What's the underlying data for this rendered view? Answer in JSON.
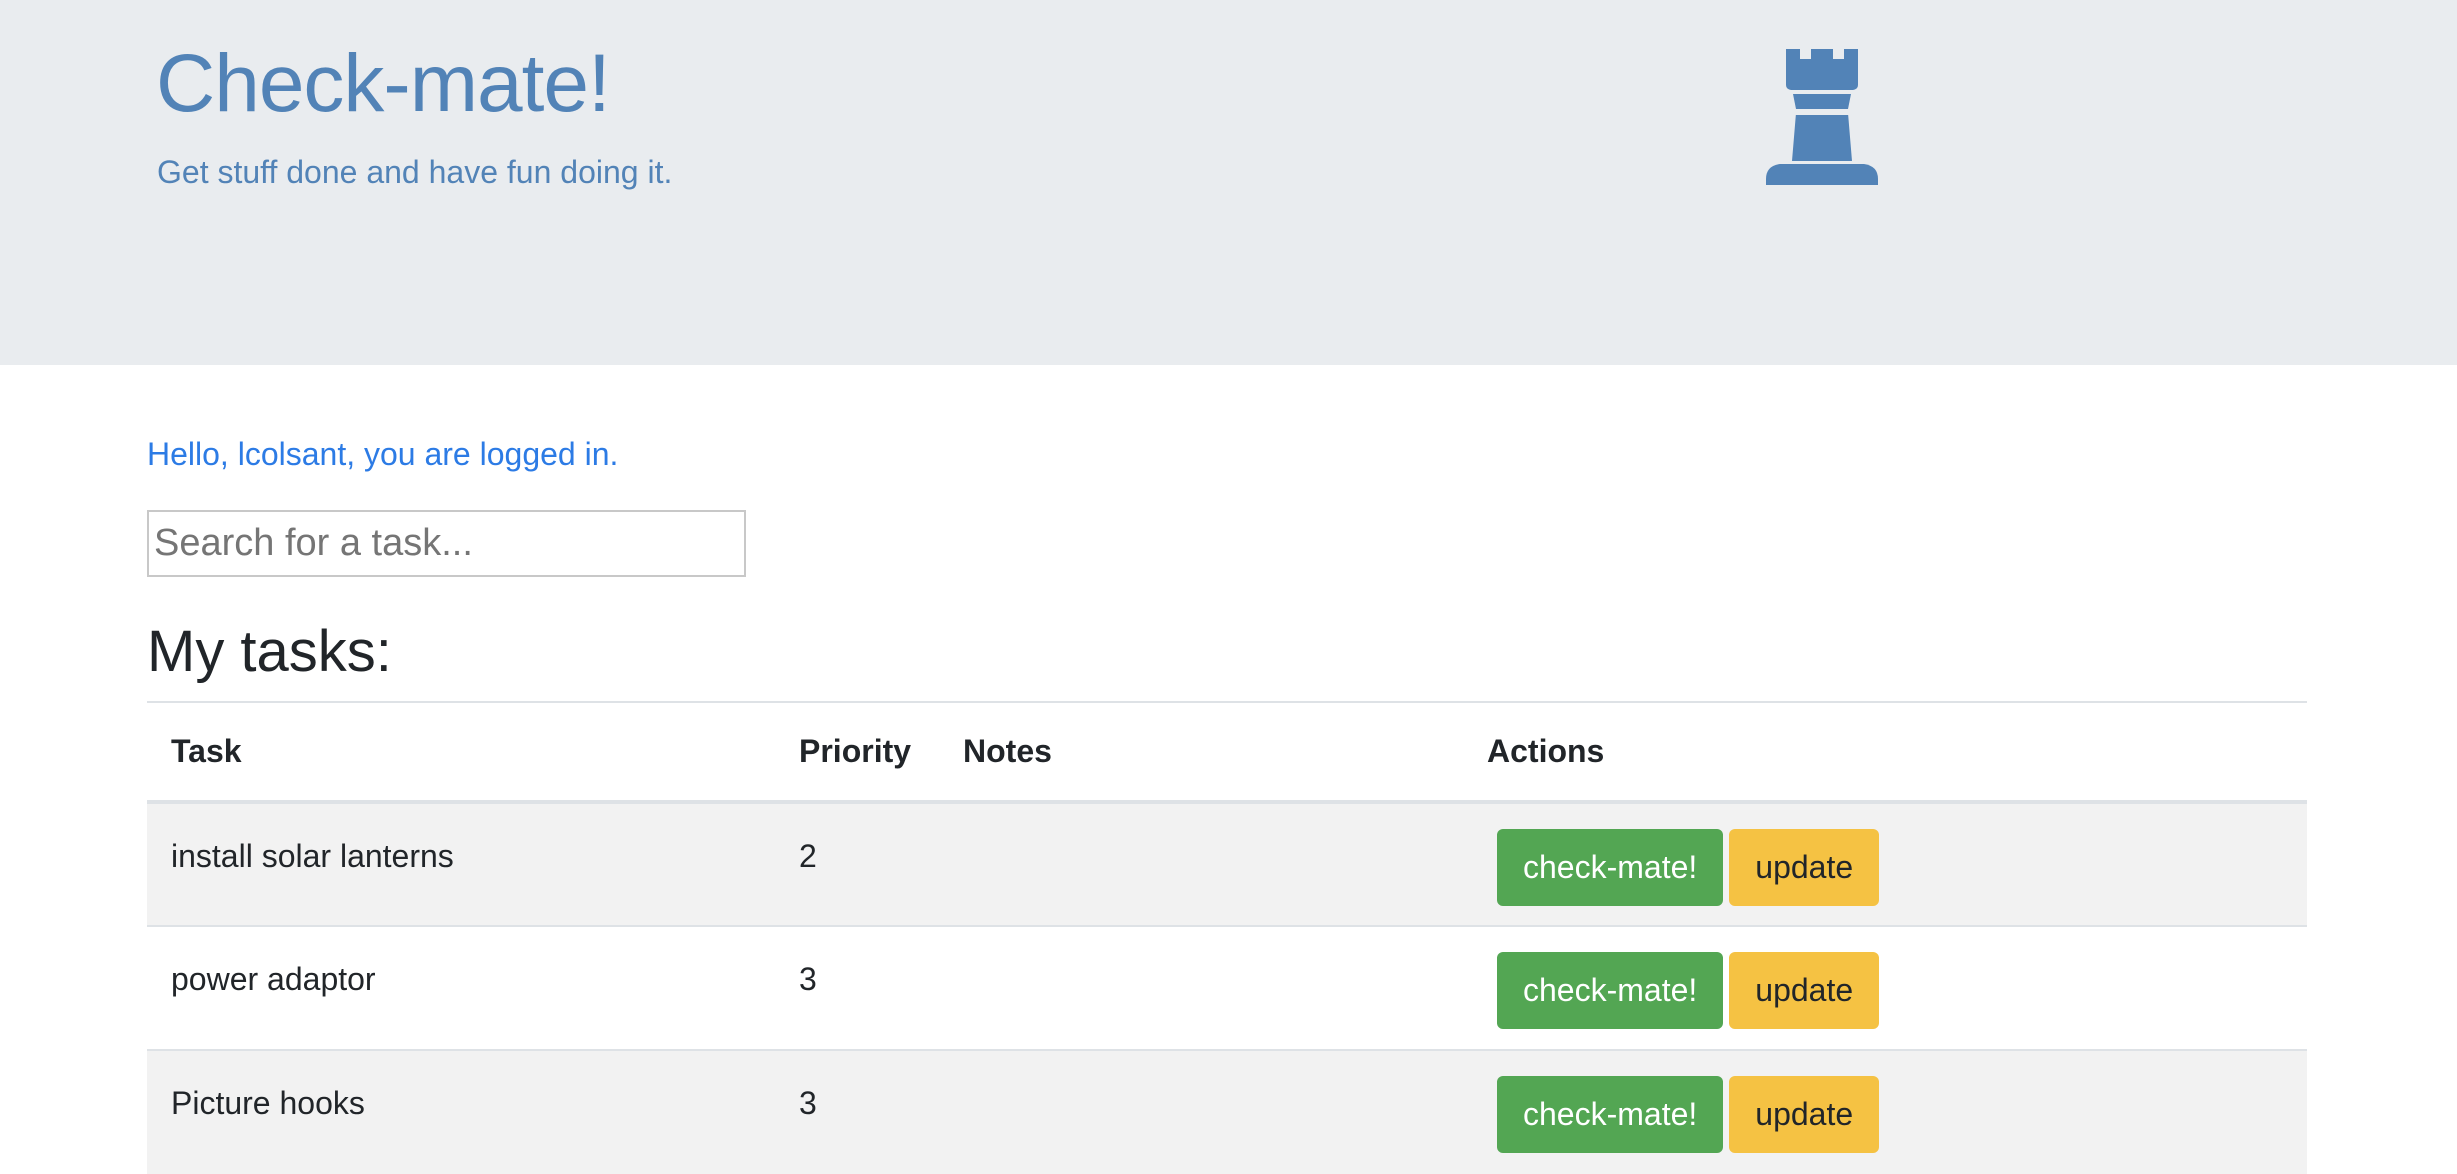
{
  "header": {
    "title": "Check-mate!",
    "tagline": "Get stuff done and have fun doing it.",
    "logo_icon": "chess-rook-icon",
    "brand_color": "#5283b7",
    "background_color": "#e9ecef"
  },
  "greeting": "Hello, lcolsant, you are logged in.",
  "search": {
    "placeholder": "Search for a task...",
    "value": ""
  },
  "tasks_section": {
    "title": "My tasks:",
    "columns": [
      "Task",
      "Priority",
      "Notes",
      "Actions"
    ],
    "rows": [
      {
        "task": "install solar lanterns",
        "priority": "2",
        "notes": "",
        "checkmate_label": "check-mate!",
        "update_label": "update"
      },
      {
        "task": "power adaptor",
        "priority": "3",
        "notes": "",
        "checkmate_label": "check-mate!",
        "update_label": "update"
      },
      {
        "task": "Picture hooks",
        "priority": "3",
        "notes": "",
        "checkmate_label": "check-mate!",
        "update_label": "update"
      }
    ]
  },
  "colors": {
    "success": "#53a653",
    "warning": "#f5c243",
    "link": "#2c7be5"
  }
}
